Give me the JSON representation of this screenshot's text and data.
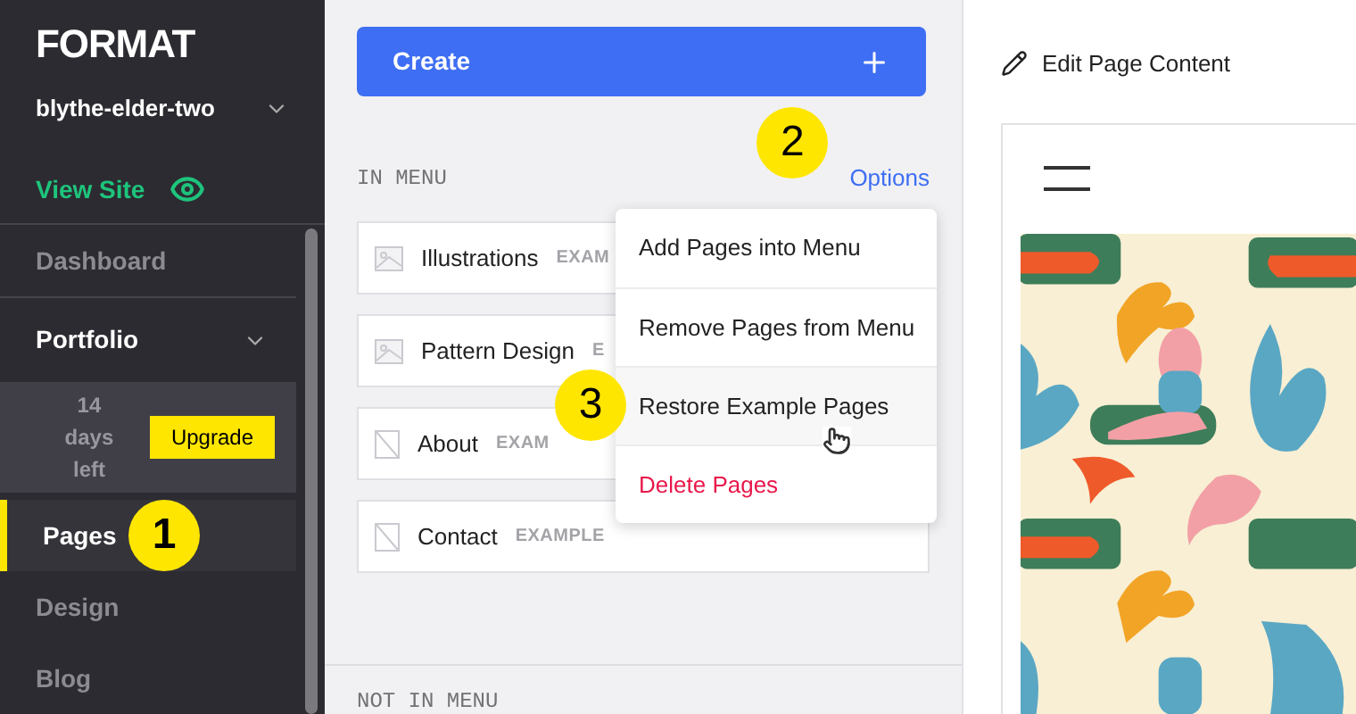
{
  "sidebar": {
    "logo": "FORMAT",
    "site": "blythe-elder-two",
    "view_site": "View Site",
    "nav": [
      {
        "kind": "link",
        "label": "Dashboard",
        "selected": false
      },
      {
        "kind": "section",
        "label": "Portfolio",
        "expanded": true
      },
      {
        "kind": "trial",
        "text": "14 days left",
        "button": "Upgrade"
      },
      {
        "kind": "link",
        "label": "Pages",
        "selected": true,
        "callout": "1"
      },
      {
        "kind": "link",
        "label": "Design",
        "selected": false
      },
      {
        "kind": "link",
        "label": "Blog",
        "selected": false
      }
    ]
  },
  "pages_panel": {
    "create_button": "Create",
    "in_menu": {
      "heading": "IN MENU",
      "options": "Options",
      "callout": "2",
      "pages": [
        {
          "title": "Illustrations",
          "tag": "EXAM",
          "kind": "gallery"
        },
        {
          "title": "Pattern Design",
          "tag": "E",
          "kind": "gallery"
        },
        {
          "title": "About",
          "tag": "EXAM",
          "kind": "blank"
        },
        {
          "title": "Contact",
          "tag": "EXAMPLE",
          "kind": "blank"
        }
      ]
    },
    "not_in_menu": {
      "heading": "NOT IN MENU"
    }
  },
  "options_menu": {
    "items": [
      {
        "label": "Add Pages into Menu",
        "kind": "normal",
        "hovered": false
      },
      {
        "label": "Remove Pages from Menu",
        "kind": "normal",
        "hovered": false
      },
      {
        "label": "Restore Example Pages",
        "kind": "normal",
        "hovered": true,
        "callout": "3"
      },
      {
        "label": "Delete Pages",
        "kind": "danger",
        "hovered": false
      }
    ]
  },
  "editor": {
    "edit_link": "Edit Page Content"
  }
}
